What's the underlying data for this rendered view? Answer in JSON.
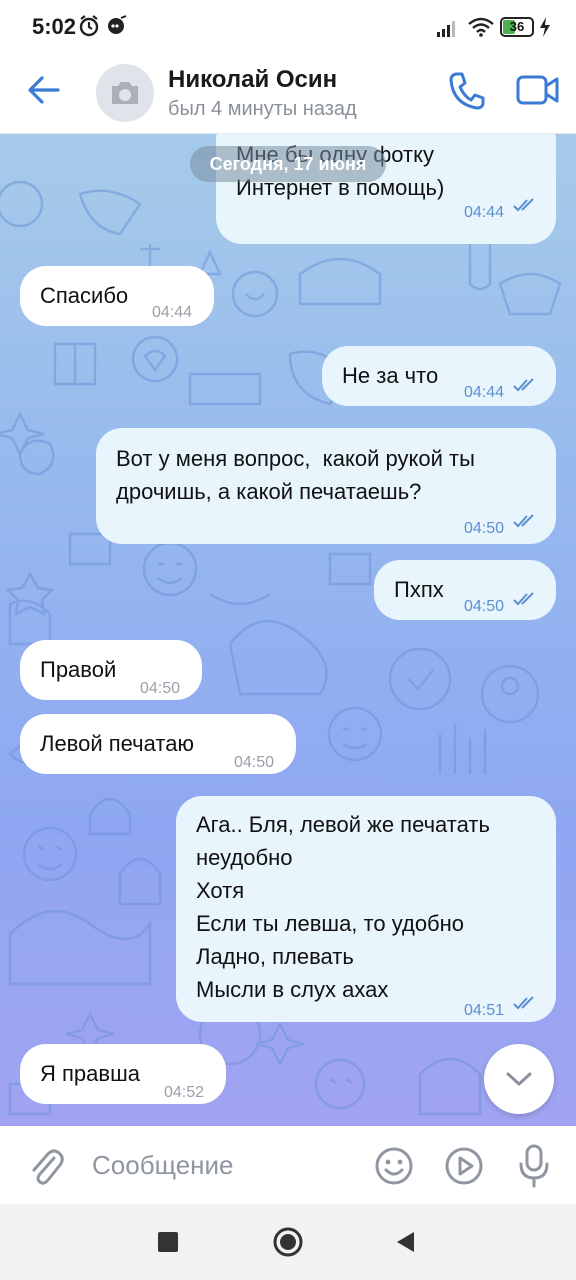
{
  "status_bar": {
    "time": "5:02",
    "battery": "36"
  },
  "header": {
    "contact_name": "Николай Осин",
    "last_seen": "был 4 минуты назад"
  },
  "chat": {
    "date_pill": "Сегодня, 17 июня",
    "messages": [
      {
        "direction": "out",
        "text": "Мне бы одну фотку\nИнтернет в помощь)",
        "time": "04:44",
        "read": true
      },
      {
        "direction": "in",
        "text": "Спасибо",
        "time": "04:44"
      },
      {
        "direction": "out",
        "text": "Не за что",
        "time": "04:44",
        "read": true
      },
      {
        "direction": "out",
        "text": "Вот у меня вопрос,  какой рукой ты\nдрочишь, а какой печатаешь?",
        "time": "04:50",
        "read": true
      },
      {
        "direction": "out",
        "text": "Пхпх",
        "time": "04:50",
        "read": true
      },
      {
        "direction": "in",
        "text": "Правой",
        "time": "04:50"
      },
      {
        "direction": "in",
        "text": "Левой печатаю",
        "time": "04:50"
      },
      {
        "direction": "out",
        "text": "Ага.. Бля, левой же печатать\nнеудобно\nХотя\nЕсли ты левша, то удобно\nЛадно, плевать\nМысли в слух ахах",
        "time": "04:51",
        "read": true
      },
      {
        "direction": "in",
        "text": "Я правша",
        "time": "04:52"
      }
    ]
  },
  "input": {
    "placeholder": "Сообщение"
  },
  "icons": {
    "back": "back-arrow-icon",
    "call": "phone-icon",
    "video": "video-camera-icon",
    "attach": "paperclip-icon",
    "emoji": "emoji-icon",
    "video_message": "play-circle-icon",
    "mic": "microphone-icon",
    "scroll_down": "chevron-down-icon"
  },
  "colors": {
    "accent": "#3a7bd5",
    "outgoing_bubble": "#e9f5fd",
    "incoming_bubble": "#ffffff"
  }
}
